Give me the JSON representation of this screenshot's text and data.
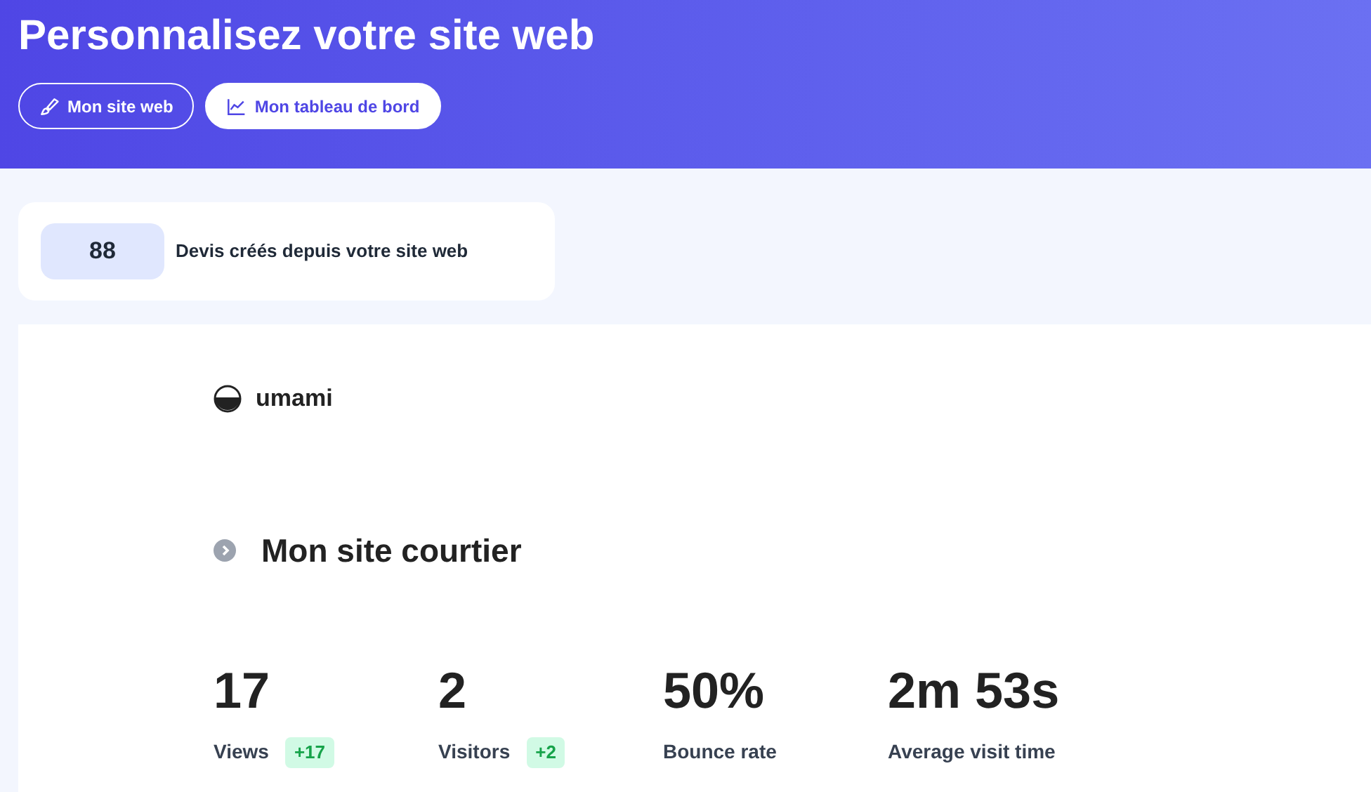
{
  "header": {
    "title": "Personnalisez votre site web",
    "buttons": [
      {
        "label": "Mon site web",
        "kind": "outline"
      },
      {
        "label": "Mon tableau de bord",
        "kind": "filled"
      }
    ]
  },
  "quote_card": {
    "count": "88",
    "label": "Devis créés depuis votre site web"
  },
  "analytics": {
    "brand": "umami",
    "site": "Mon site courtier",
    "stats": [
      {
        "value": "17",
        "label": "Views",
        "change": "+17"
      },
      {
        "value": "2",
        "label": "Visitors",
        "change": "+2"
      },
      {
        "value": "50%",
        "label": "Bounce rate"
      },
      {
        "value": "2m 53s",
        "label": "Average visit time"
      }
    ]
  }
}
